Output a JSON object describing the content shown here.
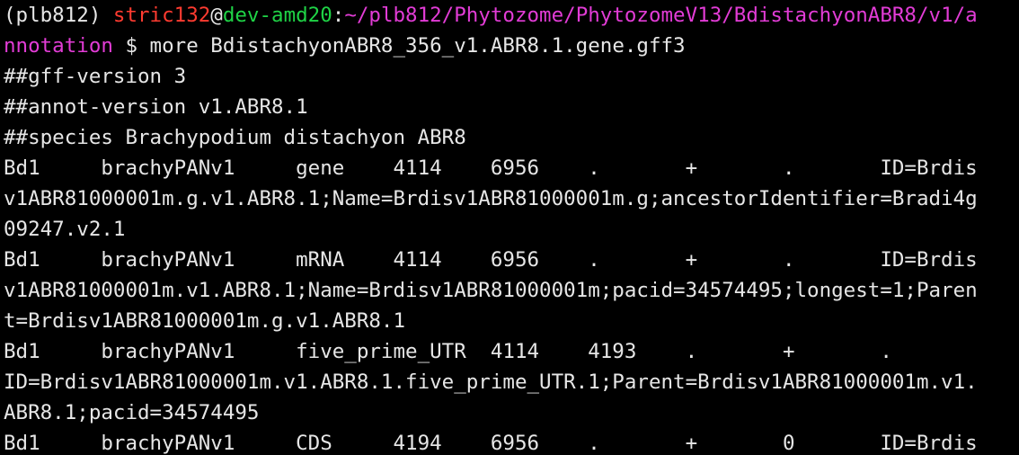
{
  "colors": {
    "background": "#000000",
    "text": "#e6e6e6",
    "user": "#ff3b30",
    "host": "#1fd346",
    "path": "#e23cd6"
  },
  "prompt": {
    "env": "(plb812) ",
    "user": "stric132",
    "at": "@",
    "host": "dev-amd20",
    "colon": ":",
    "path_line1": "~/plb812/Phytozome/PhytozomeV13/BdistachyonABR8/v1/a",
    "path_line2": "nnotation",
    "command": " $ more BdistachyonABR8_356_v1.ABR8.1.gene.gff3"
  },
  "output_lines": [
    "##gff-version 3",
    "##annot-version v1.ABR8.1",
    "##species Brachypodium distachyon ABR8",
    "Bd1     brachyPANv1     gene    4114    6956    .       +       .       ID=Brdis",
    "v1ABR81000001m.g.v1.ABR8.1;Name=Brdisv1ABR81000001m.g;ancestorIdentifier=Bradi4g",
    "09247.v2.1",
    "Bd1     brachyPANv1     mRNA    4114    6956    .       +       .       ID=Brdis",
    "v1ABR81000001m.v1.ABR8.1;Name=Brdisv1ABR81000001m;pacid=34574495;longest=1;Paren",
    "t=Brdisv1ABR81000001m.g.v1.ABR8.1",
    "Bd1     brachyPANv1     five_prime_UTR  4114    4193    .       +       .",
    "ID=Brdisv1ABR81000001m.v1.ABR8.1.five_prime_UTR.1;Parent=Brdisv1ABR81000001m.v1.",
    "ABR8.1;pacid=34574495",
    "Bd1     brachyPANv1     CDS     4194    6956    .       +       0       ID=Brdis"
  ]
}
